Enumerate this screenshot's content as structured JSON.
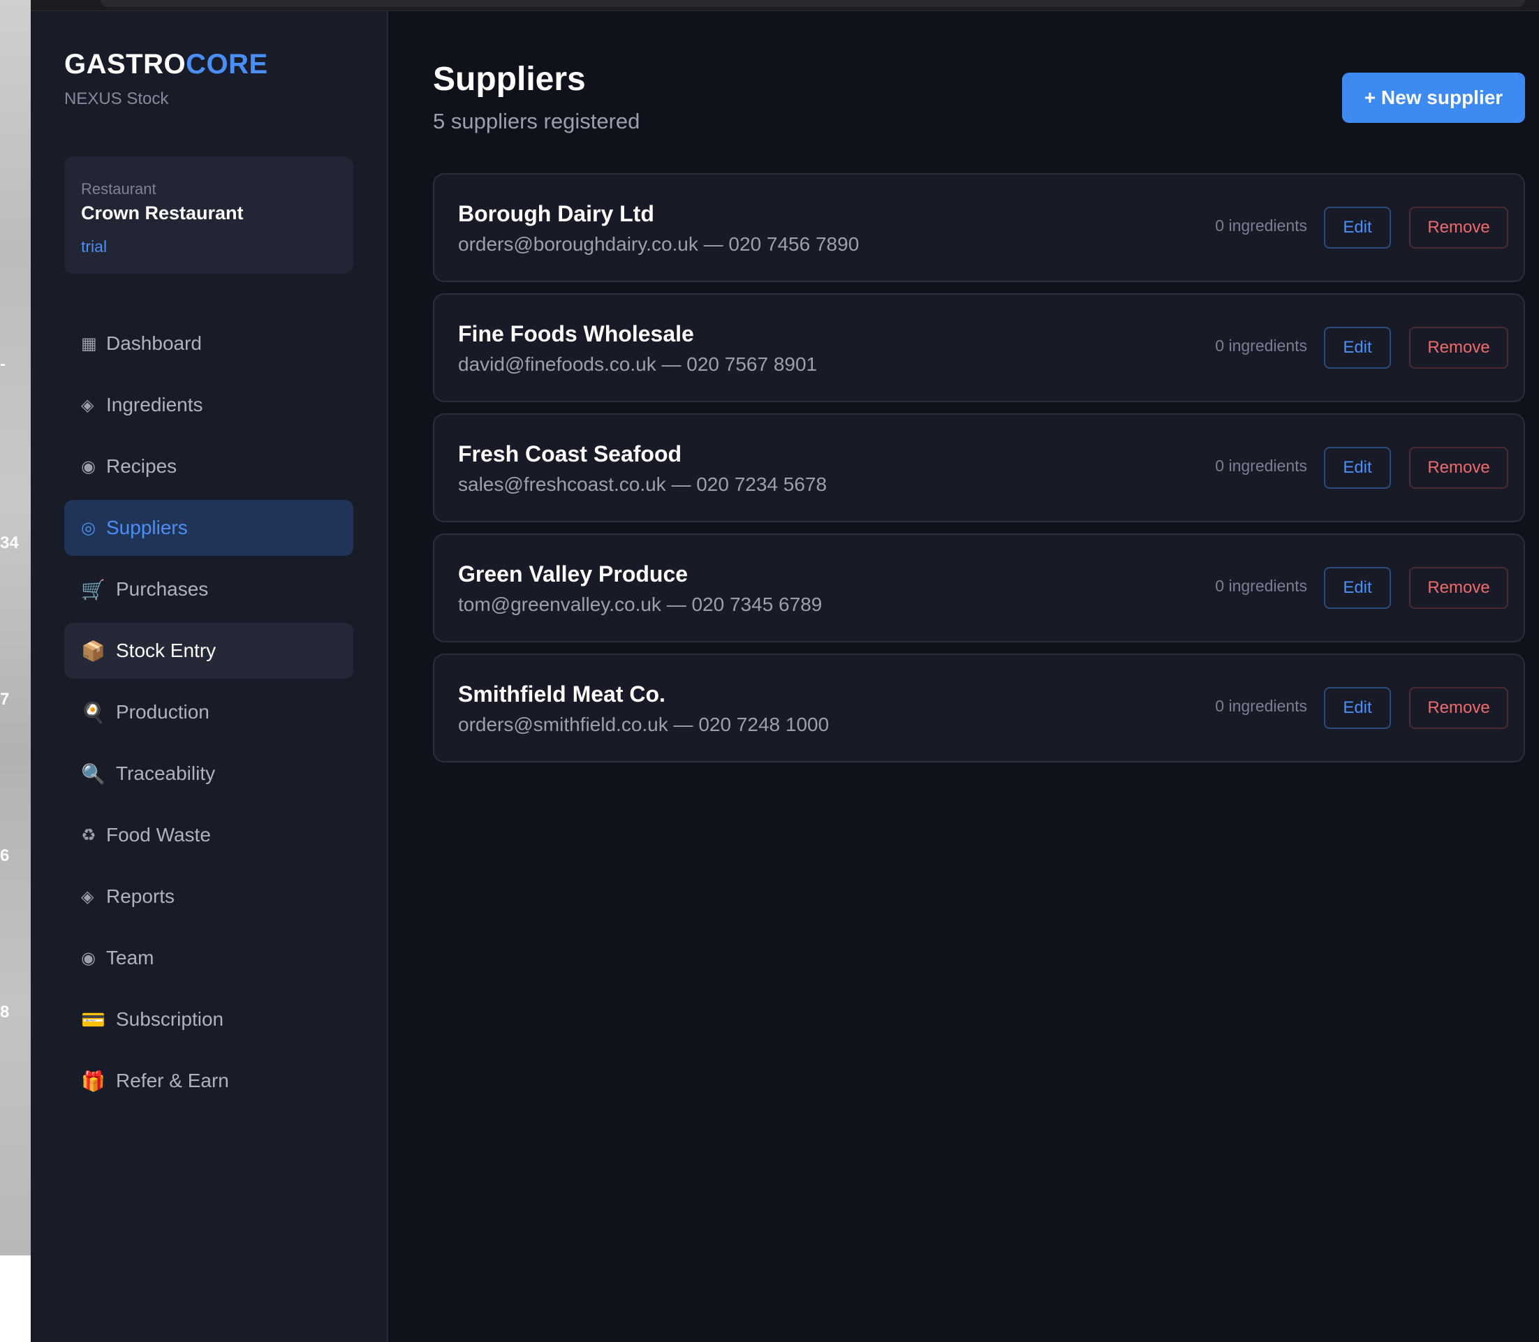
{
  "backdrop": {
    "fragments": [
      "-",
      "34",
      "7",
      "6",
      "8"
    ]
  },
  "brand": {
    "part1": "GASTRO",
    "part2": "CORE",
    "subtitle": "NEXUS Stock"
  },
  "restaurant": {
    "label": "Restaurant",
    "name": "Crown Restaurant",
    "plan": "trial"
  },
  "nav": {
    "items": [
      {
        "icon": "▦",
        "icon_name": "dashboard-icon",
        "label": "Dashboard"
      },
      {
        "icon": "◈",
        "icon_name": "ingredients-icon",
        "label": "Ingredients"
      },
      {
        "icon": "◉",
        "icon_name": "recipes-icon",
        "label": "Recipes"
      },
      {
        "icon": "◎",
        "icon_name": "suppliers-icon",
        "label": "Suppliers"
      },
      {
        "icon": "🛒",
        "icon_name": "cart-icon",
        "label": "Purchases"
      },
      {
        "icon": "📦",
        "icon_name": "package-icon",
        "label": "Stock Entry"
      },
      {
        "icon": "🍳",
        "icon_name": "cooking-icon",
        "label": "Production"
      },
      {
        "icon": "🔍",
        "icon_name": "magnifier-icon",
        "label": "Traceability"
      },
      {
        "icon": "♻",
        "icon_name": "recycle-icon",
        "label": "Food Waste"
      },
      {
        "icon": "◈",
        "icon_name": "reports-icon",
        "label": "Reports"
      },
      {
        "icon": "◉",
        "icon_name": "team-icon",
        "label": "Team"
      },
      {
        "icon": "💳",
        "icon_name": "credit-card-icon",
        "label": "Subscription"
      },
      {
        "icon": "🎁",
        "icon_name": "gift-icon",
        "label": "Refer & Earn"
      }
    ],
    "active": "Suppliers",
    "hovered": "Stock Entry"
  },
  "header": {
    "title": "Suppliers",
    "subtitle": "5 suppliers registered",
    "new_button": "+ New supplier"
  },
  "suppliers": [
    {
      "name": "Borough Dairy Ltd",
      "contact": "orders@boroughdairy.co.uk — 020 7456 7890",
      "count": "0 ingredients",
      "edit": "Edit",
      "remove": "Remove"
    },
    {
      "name": "Fine Foods Wholesale",
      "contact": "david@finefoods.co.uk — 020 7567 8901",
      "count": "0 ingredients",
      "edit": "Edit",
      "remove": "Remove"
    },
    {
      "name": "Fresh Coast Seafood",
      "contact": "sales@freshcoast.co.uk — 020 7234 5678",
      "count": "0 ingredients",
      "edit": "Edit",
      "remove": "Remove"
    },
    {
      "name": "Green Valley Produce",
      "contact": "tom@greenvalley.co.uk — 020 7345 6789",
      "count": "0 ingredients",
      "edit": "Edit",
      "remove": "Remove"
    },
    {
      "name": "Smithfield Meat Co.",
      "contact": "orders@smithfield.co.uk — 020 7248 1000",
      "count": "0 ingredients",
      "edit": "Edit",
      "remove": "Remove"
    }
  ],
  "colors": {
    "accent": "#4a8ff5",
    "danger": "#f06a6a",
    "background": "#0f111b",
    "sidebar": "#181b28"
  }
}
